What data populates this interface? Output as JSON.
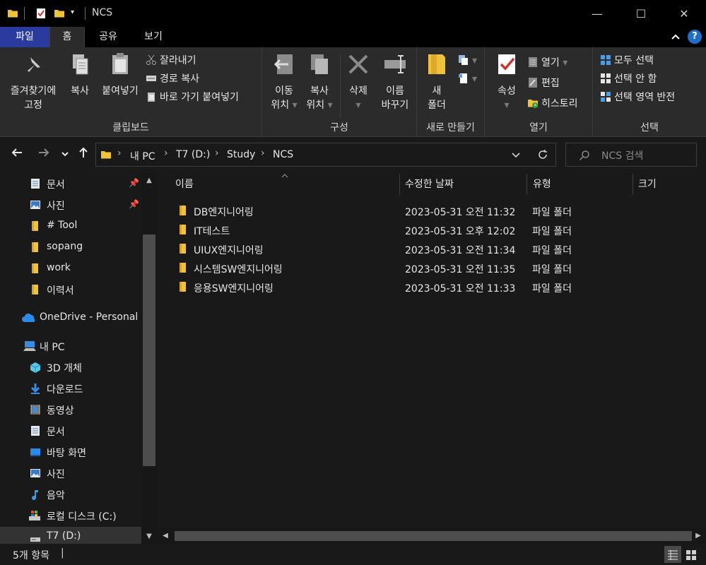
{
  "window": {
    "title": "NCS",
    "minimize": "—",
    "maximize": "☐",
    "close": "✕"
  },
  "ribbon_tabs": [
    "파일",
    "홈",
    "공유",
    "보기"
  ],
  "ribbon": {
    "clipboard": {
      "label": "클립보드",
      "pin": "즐겨찾기에\n고정",
      "pin_line1": "즐겨찾기에",
      "pin_line2": "고정",
      "copy": "복사",
      "paste": "붙여넣기",
      "cut": "잘라내기",
      "copy_path": "경로 복사",
      "paste_shortcut": "바로 가기 붙여넣기"
    },
    "organize": {
      "label": "구성",
      "move_line1": "이동",
      "move_line2": "위치",
      "copyto_line1": "복사",
      "copyto_line2": "위치",
      "delete": "삭제",
      "rename_line1": "이름",
      "rename_line2": "바꾸기"
    },
    "new": {
      "label": "새로 만들기",
      "folder_line1": "새",
      "folder_line2": "폴더"
    },
    "open": {
      "label": "열기",
      "properties": "속성",
      "open": "열기",
      "edit": "편집",
      "history": "히스토리"
    },
    "select": {
      "label": "선택",
      "all": "모두 선택",
      "none": "선택 안 함",
      "invert": "선택 영역 반전"
    }
  },
  "address": {
    "crumbs": [
      "내 PC",
      "T7 (D:)",
      "Study",
      "NCS"
    ],
    "search_placeholder": "NCS 검색"
  },
  "nav": {
    "quick": [
      {
        "label": "문서",
        "icon": "document-icon",
        "pinned": true
      },
      {
        "label": "사진",
        "icon": "picture-icon",
        "pinned": true
      },
      {
        "label": "# Tool",
        "icon": "folder-icon",
        "pinned": false
      },
      {
        "label": "sopang",
        "icon": "folder-icon",
        "pinned": false
      },
      {
        "label": "work",
        "icon": "folder-icon",
        "pinned": false
      },
      {
        "label": "이력서",
        "icon": "folder-icon",
        "pinned": false
      }
    ],
    "onedrive": "OneDrive - Personal",
    "thispc": "내 PC",
    "pc_items": [
      {
        "label": "3D 개체",
        "icon": "3d-objects-icon"
      },
      {
        "label": "다운로드",
        "icon": "download-icon"
      },
      {
        "label": "동영상",
        "icon": "video-icon"
      },
      {
        "label": "문서",
        "icon": "document-icon"
      },
      {
        "label": "바탕 화면",
        "icon": "desktop-icon"
      },
      {
        "label": "사진",
        "icon": "picture-icon"
      },
      {
        "label": "음악",
        "icon": "music-icon"
      },
      {
        "label": "로컬 디스크 (C:)",
        "icon": "local-disk-icon"
      },
      {
        "label": "T7 (D:)",
        "icon": "drive-icon"
      }
    ]
  },
  "columns": [
    "이름",
    "수정한 날짜",
    "유형",
    "크기"
  ],
  "files": [
    {
      "name": "DB엔지니어링",
      "date": "2023-05-31 오전 11:32",
      "type": "파일 폴더"
    },
    {
      "name": "IT테스트",
      "date": "2023-05-31 오후 12:02",
      "type": "파일 폴더"
    },
    {
      "name": "UIUX엔지니어링",
      "date": "2023-05-31 오전 11:34",
      "type": "파일 폴더"
    },
    {
      "name": "시스템SW엔지니어링",
      "date": "2023-05-31 오전 11:35",
      "type": "파일 폴더"
    },
    {
      "name": "응용SW엔지니어링",
      "date": "2023-05-31 오전 11:33",
      "type": "파일 폴더"
    }
  ],
  "status": {
    "count": "5개 항목"
  },
  "colors": {
    "accent": "#2b3a9e",
    "folder": "#f0c23c",
    "background": "#191919",
    "ribbon": "#2b2b2b"
  }
}
